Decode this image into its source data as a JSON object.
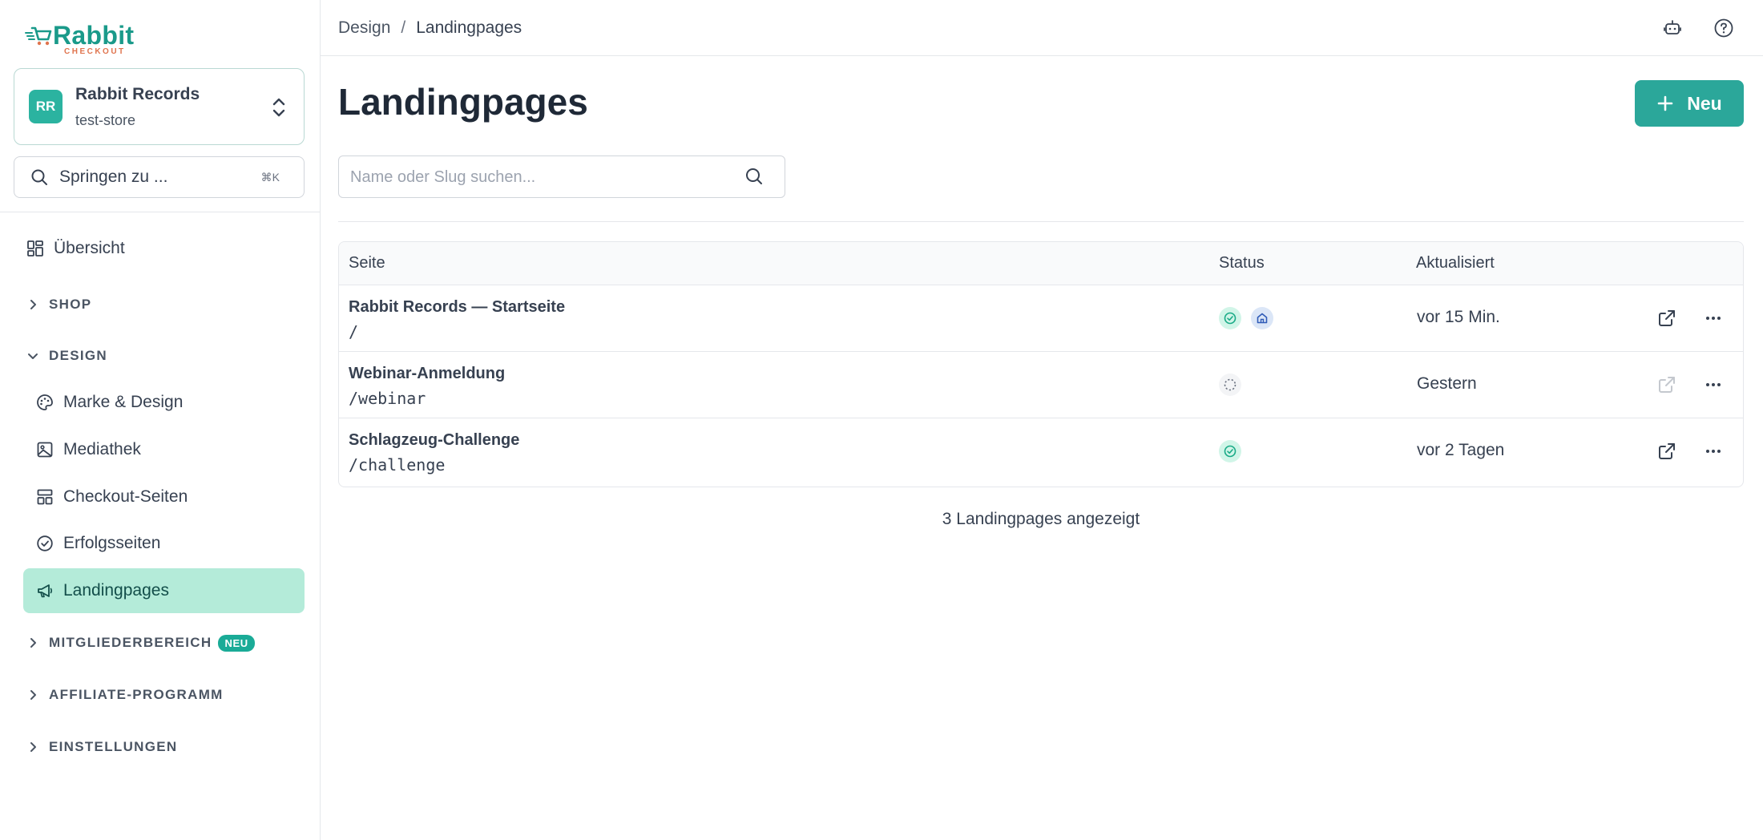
{
  "brand": {
    "logo_main": "Rabbit",
    "logo_sub": "CHECKOUT",
    "accent": "#2ba79a"
  },
  "store": {
    "initials": "RR",
    "name": "Rabbit Records",
    "slug": "test-store"
  },
  "jump": {
    "label": "Springen zu ...",
    "shortcut": "⌘K"
  },
  "sidebar": {
    "overview": "Übersicht",
    "shop": "SHOP",
    "design": "DESIGN",
    "design_items": [
      "Marke & Design",
      "Mediathek",
      "Checkout-Seiten",
      "Erfolgsseiten",
      "Landingpages"
    ],
    "members": "MITGLIEDERBEREICH",
    "members_badge": "NEU",
    "affiliate": "AFFILIATE-PROGRAMM",
    "settings": "EINSTELLUNGEN"
  },
  "breadcrumb": {
    "parent": "Design",
    "separator": "/",
    "current": "Landingpages"
  },
  "page": {
    "title": "Landingpages",
    "new_button": "Neu",
    "search_placeholder": "Name oder Slug suchen..."
  },
  "table": {
    "headers": {
      "page": "Seite",
      "status": "Status",
      "updated": "Aktualisiert"
    },
    "rows": [
      {
        "name": "Rabbit Records — Startseite",
        "slug": "/",
        "status": [
          "published",
          "home"
        ],
        "updated": "vor 15 Min."
      },
      {
        "name": "Webinar-Anmeldung",
        "slug": "/webinar",
        "status": [
          "draft"
        ],
        "updated": "Gestern"
      },
      {
        "name": "Schlagzeug-Challenge",
        "slug": "/challenge",
        "status": [
          "published"
        ],
        "updated": "vor 2 Tagen"
      }
    ]
  },
  "footer": {
    "count_text": "3 Landingpages angezeigt"
  }
}
